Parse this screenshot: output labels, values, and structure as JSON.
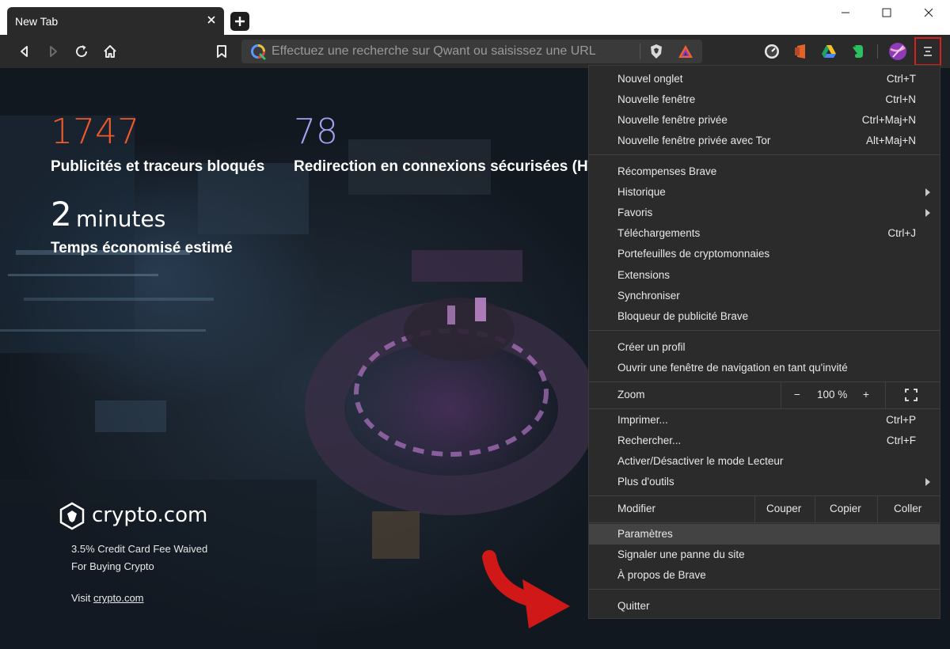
{
  "tab": {
    "title": "New Tab",
    "close_icon": "close-icon"
  },
  "toolbar": {
    "search_placeholder": "Effectuez une recherche sur Qwant ou saisissez une URL"
  },
  "stats": {
    "ads_count": "1747",
    "ads_label": "Publicités et traceurs bloqués",
    "https_count": "78",
    "https_label": "Redirection en connexions sécurisées (HT",
    "time_value": "2",
    "time_unit": "minutes",
    "time_label": "Temps économisé estimé",
    "colors": {
      "ads": "#ef5a2a",
      "https": "#a79ff0"
    }
  },
  "sponsor": {
    "name": "crypto.com",
    "line1": "3.5% Credit Card Fee Waived",
    "line2": "For Buying Crypto",
    "visit_prefix": "Visit ",
    "visit_link": "crypto.com"
  },
  "menu": {
    "group1": [
      {
        "label": "Nouvel onglet",
        "shortcut": "Ctrl+T"
      },
      {
        "label": "Nouvelle fenêtre",
        "shortcut": "Ctrl+N"
      },
      {
        "label": "Nouvelle fenêtre privée",
        "shortcut": "Ctrl+Maj+N"
      },
      {
        "label": "Nouvelle fenêtre privée avec Tor",
        "shortcut": "Alt+Maj+N"
      }
    ],
    "group2": [
      {
        "label": "Récompenses Brave",
        "shortcut": ""
      },
      {
        "label": "Historique",
        "shortcut": ""
      },
      {
        "label": "Favoris",
        "shortcut": ""
      },
      {
        "label": "Téléchargements",
        "shortcut": "Ctrl+J"
      },
      {
        "label": "Portefeuilles de cryptomonnaies",
        "shortcut": ""
      },
      {
        "label": "Extensions",
        "shortcut": ""
      },
      {
        "label": "Synchroniser",
        "shortcut": ""
      },
      {
        "label": "Bloqueur de publicité Brave",
        "shortcut": ""
      }
    ],
    "group3": [
      {
        "label": "Créer un profil"
      },
      {
        "label": "Ouvrir une fenêtre de navigation en tant qu'invité"
      }
    ],
    "zoom": {
      "label": "Zoom",
      "minus": "−",
      "value": "100 %",
      "plus": "+"
    },
    "group4": [
      {
        "label": "Imprimer...",
        "shortcut": "Ctrl+P"
      },
      {
        "label": "Rechercher...",
        "shortcut": "Ctrl+F"
      },
      {
        "label": "Activer/Désactiver le mode Lecteur",
        "shortcut": ""
      },
      {
        "label": "Plus d'outils",
        "shortcut": ""
      }
    ],
    "edit": {
      "label": "Modifier",
      "cut": "Couper",
      "copy": "Copier",
      "paste": "Coller"
    },
    "group5": [
      {
        "label": "Paramètres"
      },
      {
        "label": "Signaler une panne du site"
      },
      {
        "label": "À propos de Brave"
      }
    ],
    "quit": "Quitter"
  },
  "highlight_color": "#d62020"
}
